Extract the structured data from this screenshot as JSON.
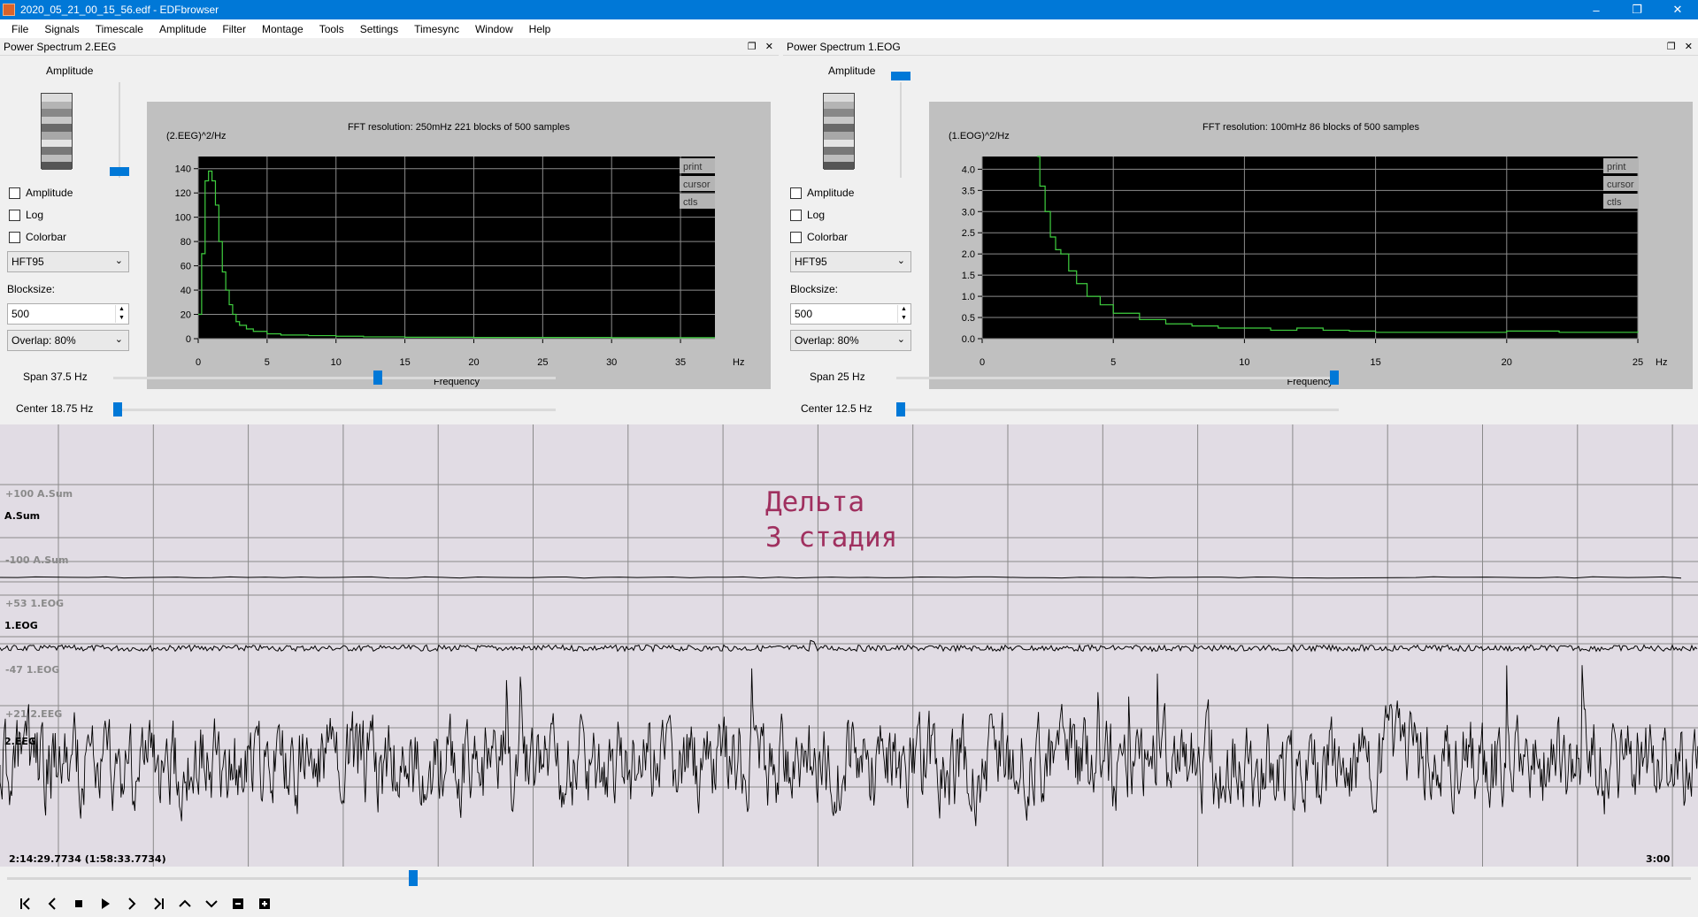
{
  "window": {
    "title": "2020_05_21_00_15_56.edf - EDFbrowser",
    "icon": "edf-app-icon"
  },
  "window_controls": {
    "minimize": "–",
    "maximize": "❐",
    "close": "✕"
  },
  "menu": [
    "File",
    "Signals",
    "Timescale",
    "Amplitude",
    "Filter",
    "Montage",
    "Tools",
    "Settings",
    "Timesync",
    "Window",
    "Help"
  ],
  "panels": {
    "left": {
      "title": "Power Spectrum 2.EEG",
      "amplitude_label": "Amplitude",
      "checkboxes": [
        "Amplitude",
        "Log",
        "Colorbar"
      ],
      "window_combo": "HFT95",
      "blocksize_label": "Blocksize:",
      "blocksize": "500",
      "overlap": "Overlap: 80%",
      "info": "FFT resolution: 250mHz   221 blocks of 500 samples",
      "ylabel": "(2.EEG)^2/Hz",
      "xlabel": "Frequency",
      "xunit": "Hz",
      "buttons": [
        "print",
        "cursor",
        "ctls"
      ],
      "span": "Span 37.5 Hz",
      "center": "Center 18.75 Hz",
      "amplitude_level": 0.0,
      "span_fraction": 0.6,
      "center_fraction": 0.0
    },
    "right": {
      "title": "Power Spectrum 1.EOG",
      "amplitude_label": "Amplitude",
      "checkboxes": [
        "Amplitude",
        "Log",
        "Colorbar"
      ],
      "window_combo": "HFT95",
      "blocksize_label": "Blocksize:",
      "blocksize": "500",
      "overlap": "Overlap: 80%",
      "info": "FFT resolution: 100mHz   86 blocks of 500 samples",
      "ylabel": "(1.EOG)^2/Hz",
      "xlabel": "Frequency",
      "xunit": "Hz",
      "buttons": [
        "print",
        "cursor",
        "ctls"
      ],
      "span": "Span 25 Hz",
      "center": "Center 12.5 Hz",
      "amplitude_level": 1.0,
      "span_fraction": 1.0,
      "center_fraction": 0.0
    }
  },
  "chart_data": [
    {
      "type": "line",
      "ylabel": "(2.EEG)^2/Hz",
      "xlabel": "Frequency",
      "xlim": [
        0,
        37.5
      ],
      "ylim": [
        0,
        150
      ],
      "xticks": [
        0,
        5,
        10,
        15,
        20,
        25,
        30,
        35
      ],
      "yticks": [
        0,
        20,
        40,
        60,
        80,
        100,
        120,
        140
      ],
      "grid": true,
      "series": [
        {
          "color": "#3fcf3f",
          "x": [
            0,
            0.25,
            0.5,
            0.75,
            1.0,
            1.25,
            1.5,
            1.75,
            2.0,
            2.25,
            2.5,
            2.75,
            3.0,
            3.5,
            4.0,
            5.0,
            6.0,
            8.0,
            10.0,
            12.0,
            15.0,
            20.0,
            25.0,
            30.0,
            35.0,
            37.5
          ],
          "y": [
            20,
            70,
            130,
            138,
            130,
            110,
            80,
            55,
            40,
            28,
            20,
            14,
            11,
            8,
            6,
            4,
            3,
            2.5,
            2,
            1.5,
            1.2,
            1,
            1,
            0.8,
            0.8,
            0.8
          ]
        }
      ]
    },
    {
      "type": "line",
      "ylabel": "(1.EOG)^2/Hz",
      "xlabel": "Frequency",
      "xlim": [
        0,
        25
      ],
      "ylim": [
        0,
        4.3
      ],
      "xticks": [
        0,
        5,
        10,
        15,
        20,
        25
      ],
      "yticks": [
        0.0,
        0.5,
        1.0,
        1.5,
        2.0,
        2.5,
        3.0,
        3.5,
        4.0
      ],
      "grid": true,
      "series": [
        {
          "color": "#3fcf3f",
          "x": [
            2.1,
            2.2,
            2.4,
            2.6,
            2.8,
            3.0,
            3.3,
            3.6,
            4.0,
            4.5,
            5.0,
            6.0,
            7.0,
            8.0,
            9.0,
            10.0,
            11.0,
            12.0,
            13.0,
            14.0,
            15.0,
            17.0,
            19.0,
            20.0,
            22.0,
            24.0,
            25.0
          ],
          "y": [
            4.3,
            3.6,
            3.0,
            2.4,
            2.1,
            2.0,
            1.6,
            1.3,
            1.0,
            0.8,
            0.6,
            0.45,
            0.35,
            0.3,
            0.25,
            0.25,
            0.2,
            0.25,
            0.2,
            0.18,
            0.15,
            0.15,
            0.15,
            0.18,
            0.15,
            0.15,
            0.18
          ]
        }
      ]
    }
  ],
  "signals": [
    {
      "name": "A.Sum",
      "upper": "+100 A.Sum",
      "lower": "-100 A.Sum"
    },
    {
      "name": "1.EOG",
      "upper": "+53 1.EOG",
      "lower": "-47 1.EOG"
    },
    {
      "name": "2.EEG",
      "upper": "+21 2.EEG",
      "lower": ""
    }
  ],
  "annotation": "Дельта\n3 стадия",
  "time_left": "2:14:29.7734 (1:58:33.7734)",
  "time_right": "3:00",
  "scroll_position": 0.24,
  "nav_buttons": [
    {
      "name": "first-icon",
      "glyph": "K"
    },
    {
      "name": "prev-icon",
      "glyph": "‹"
    },
    {
      "name": "stop-icon",
      "glyph": "■"
    },
    {
      "name": "play-icon",
      "glyph": "▶"
    },
    {
      "name": "next-icon",
      "glyph": "›"
    },
    {
      "name": "last-icon",
      "glyph": "›|"
    },
    {
      "name": "up-icon",
      "glyph": "˄"
    },
    {
      "name": "down-icon",
      "glyph": "˅"
    },
    {
      "name": "zoom-out-icon",
      "glyph": "⊟"
    },
    {
      "name": "zoom-in-icon",
      "glyph": "⊞"
    }
  ]
}
